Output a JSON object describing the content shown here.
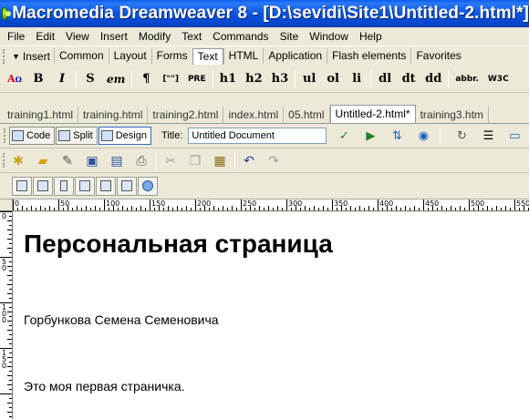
{
  "window": {
    "title": "Macromedia Dreamweaver 8 - [D:\\sevidi\\Site1\\Untitled-2.html*]"
  },
  "menu": [
    "File",
    "Edit",
    "View",
    "Insert",
    "Modify",
    "Text",
    "Commands",
    "Site",
    "Window",
    "Help"
  ],
  "insert_bar": {
    "label": "Insert",
    "tabs": [
      "Common",
      "Layout",
      "Forms",
      "Text",
      "HTML",
      "Application",
      "Flash elements",
      "Favorites"
    ],
    "active_tab": "Text",
    "text_tools": [
      "B",
      "I",
      "S",
      "em",
      "¶",
      "[\"\"]",
      "PRE",
      "h1",
      "h2",
      "h3",
      "ul",
      "ol",
      "li",
      "dl",
      "dt",
      "dd",
      "abbr.",
      "W3C"
    ]
  },
  "doc_tabs": [
    "training1.html",
    "training.html",
    "training2.html",
    "index.html",
    "05.html",
    "Untitled-2.html*",
    "training3.htm"
  ],
  "doc_toolbar": {
    "code_label": "Code",
    "split_label": "Split",
    "design_label": "Design",
    "title_label": "Title:",
    "title_value": "Untitled Document"
  },
  "ruler": {
    "h_labels": [
      "0",
      "50",
      "100",
      "150",
      "200",
      "250",
      "300",
      "350",
      "400",
      "450",
      "500",
      "550"
    ],
    "v_labels": [
      "0",
      "50",
      "100",
      "150"
    ]
  },
  "document": {
    "heading": "Персональная страница",
    "paragraph1": "Горбункова Семена Семеновича",
    "paragraph2": "Это моя первая страничка."
  },
  "icons": [
    "app-logo-icon",
    "format-text-icon",
    "file-manager-icon",
    "preview-icon",
    "refresh-icon",
    "view-options-icon",
    "new-file-icon",
    "open-icon",
    "save-icon",
    "save-all-icon",
    "print-icon",
    "cut-icon",
    "copy-icon",
    "paste-icon",
    "undo-icon",
    "redo-icon"
  ]
}
